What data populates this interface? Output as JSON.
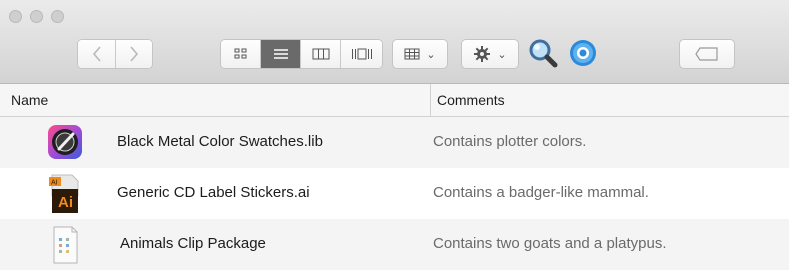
{
  "window": {
    "toolbar": {
      "nav": {
        "back_icon": "chevron-left-icon",
        "forward_icon": "chevron-right-icon"
      },
      "view_modes": [
        {
          "icon": "icon-view-icon",
          "selected": false
        },
        {
          "icon": "list-view-icon",
          "selected": true
        },
        {
          "icon": "column-view-icon",
          "selected": false
        },
        {
          "icon": "cover-flow-view-icon",
          "selected": false
        }
      ],
      "arrange_icon": "arrange-grid-icon",
      "action_icon": "gear-icon",
      "search_icon": "magnifier-icon",
      "extra_icon": "globe-badge-icon",
      "tag_icon": "tag-icon"
    },
    "columns": {
      "name": "Name",
      "comments": "Comments"
    },
    "files": [
      {
        "name": "Black Metal Color Swatches.lib",
        "comment": "Contains plotter colors.",
        "icon": "color-swatch-app-icon"
      },
      {
        "name": "Generic CD Label Stickers.ai",
        "comment": "Contains a badger-like mammal.",
        "icon": "illustrator-file-icon",
        "icon_text": "Ai"
      },
      {
        "name": "Animals Clip Package",
        "comment": "Contains two goats and a platypus.",
        "icon": "document-package-icon"
      }
    ],
    "colors": {
      "ai_orange": "#f08a1d",
      "ai_dark": "#2b1a07",
      "selected_segment": "#6a6a6a",
      "comment_text": "#6a6a6a"
    }
  }
}
